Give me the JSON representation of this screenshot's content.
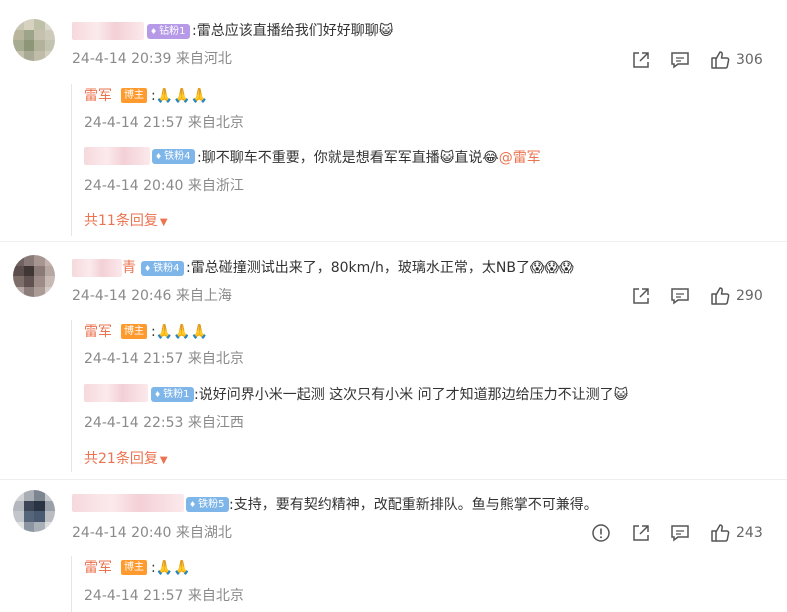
{
  "comments": [
    {
      "badge": "钻粉1",
      "text": ":雷总应该直播给我们好好聊聊",
      "emoji_tail": "😺",
      "meta": "24-4-14 20:39 来自河北",
      "likes": "306",
      "replies": [
        {
          "name": "雷军",
          "host_badge": "博主",
          "text": ":",
          "emojis": "🙏🙏🙏",
          "meta": "24-4-14 21:57 来自北京"
        },
        {
          "badge": "铁粉4",
          "text": ":聊不聊车不重要，你就是想看军军直播",
          "emoji1": "😺",
          "text2": "直说",
          "emoji2": "😂",
          "mention": "@雷军",
          "meta": "24-4-14 20:40 来自浙江"
        }
      ],
      "more": "共11条回复"
    },
    {
      "name_tail": "青",
      "badge": "铁粉4",
      "text": ":雷总碰撞测试出来了，80km/h，玻璃水正常，太NB了",
      "emoji_tail": "😱😱😱",
      "meta": "24-4-14 20:46 来自上海",
      "likes": "290",
      "replies": [
        {
          "name": "雷军",
          "host_badge": "博主",
          "text": ":",
          "emojis": "🙏🙏🙏",
          "meta": "24-4-14 21:57 来自北京"
        },
        {
          "badge": "铁粉1",
          "text": ":说好问界小米一起测   这次只有小米    问了才知道那边给压力不让测了",
          "emoji_tail": "😺",
          "meta": "24-4-14 22:53 来自江西"
        }
      ],
      "more": "共21条回复"
    },
    {
      "badge": "铁粉5",
      "text": ":支持，要有契约精神，改配重新排队。鱼与熊掌不可兼得。",
      "meta": "24-4-14 20:40 来自湖北",
      "likes": "243",
      "replies": [
        {
          "name": "雷军",
          "host_badge": "博主",
          "text": ":",
          "emojis": "🙏🙏",
          "meta": "24-4-14 21:57 来自北京"
        }
      ]
    }
  ],
  "icons": {
    "share": "share-icon",
    "comment": "comment-icon",
    "like": "thumbs-up-icon",
    "report": "report-icon"
  }
}
